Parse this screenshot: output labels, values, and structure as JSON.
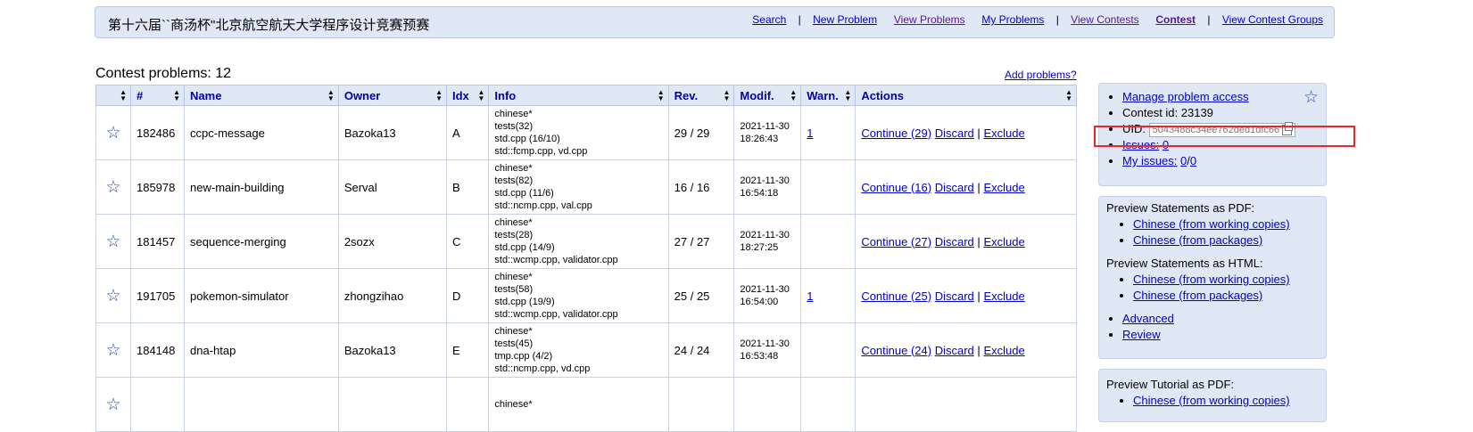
{
  "header": {
    "title": "第十六届``商汤杯\"北京航空航天大学程序设计竞赛预赛",
    "nav": {
      "search": "Search",
      "new_problem": "New Problem",
      "view_problems": "View Problems",
      "my_problems": "My Problems",
      "view_contests": "View Contests",
      "contest": "Contest",
      "view_contest_groups": "View Contest Groups",
      "separator": "|"
    }
  },
  "contest": {
    "heading": "Contest problems: 12",
    "add_problems": "Add problems?"
  },
  "table": {
    "columns": {
      "hash": "#",
      "name": "Name",
      "owner": "Owner",
      "idx": "Idx",
      "info": "Info",
      "rev": "Rev.",
      "modif": "Modif.",
      "warn": "Warn.",
      "actions": "Actions"
    },
    "sort_icon": "sort-arrows-icon",
    "star_icon": "star-icon",
    "action_labels": {
      "discard": "Discard",
      "exclude": "Exclude",
      "pipe": "|"
    },
    "rows": [
      {
        "id": "182486",
        "name": "ccpc-message",
        "owner": "Bazoka13",
        "idx": "A",
        "info": [
          "chinese*",
          "tests(32)",
          "std.cpp (16/10)",
          "std::fcmp.cpp, vd.cpp"
        ],
        "rev": "29 / 29",
        "date": "2021-11-30",
        "time": "18:26:43",
        "warn": "1",
        "continue": "Continue (29)"
      },
      {
        "id": "185978",
        "name": "new-main-building",
        "owner": "Serval",
        "idx": "B",
        "info": [
          "chinese*",
          "tests(82)",
          "std.cpp (11/6)",
          "std::ncmp.cpp, val.cpp"
        ],
        "rev": "16 / 16",
        "date": "2021-11-30",
        "time": "16:54:18",
        "warn": "",
        "continue": "Continue (16)"
      },
      {
        "id": "181457",
        "name": "sequence-merging",
        "owner": "2sozx",
        "idx": "C",
        "info": [
          "chinese*",
          "tests(28)",
          "std.cpp (14/9)",
          "std::wcmp.cpp, validator.cpp"
        ],
        "rev": "27 / 27",
        "date": "2021-11-30",
        "time": "18:27:25",
        "warn": "",
        "continue": "Continue (27)"
      },
      {
        "id": "191705",
        "name": "pokemon-simulator",
        "owner": "zhongzihao",
        "idx": "D",
        "info": [
          "chinese*",
          "tests(58)",
          "std.cpp (19/9)",
          "std::wcmp.cpp, validator.cpp"
        ],
        "rev": "25 / 25",
        "date": "2021-11-30",
        "time": "16:54:00",
        "warn": "1",
        "continue": "Continue (25)"
      },
      {
        "id": "184148",
        "name": "dna-htap",
        "owner": "Bazoka13",
        "idx": "E",
        "info": [
          "chinese*",
          "tests(45)",
          "tmp.cpp (4/2)",
          "std::ncmp.cpp, vd.cpp"
        ],
        "rev": "24 / 24",
        "date": "2021-11-30",
        "time": "16:53:48",
        "warn": "",
        "continue": "Continue (24)"
      },
      {
        "id": "",
        "name": "",
        "owner": "",
        "idx": "",
        "info": [
          "chinese*"
        ],
        "rev": "",
        "date": "",
        "time": "",
        "warn": "",
        "continue": ""
      }
    ]
  },
  "sidebar": {
    "box1": {
      "manage_access": "Manage problem access",
      "contest_id": "Contest id: 23139",
      "uid_label": "UID:",
      "uid_value": "5043488c34ee762ded1dfc66",
      "issues_label": "Issues:",
      "issues_count": "0",
      "my_issues_label": "My issues:",
      "my_issues_open": "0",
      "my_issues_total": "0",
      "slash": "/"
    },
    "box2": {
      "pdf_heading": "Preview Statements as PDF:",
      "pdf_items": [
        "Chinese (from working copies)",
        "Chinese (from packages)"
      ],
      "html_heading": "Preview Statements as HTML:",
      "html_items": [
        "Chinese (from working copies)",
        "Chinese (from packages)"
      ],
      "advanced": "Advanced",
      "review": "Review"
    },
    "box3": {
      "heading": "Preview Tutorial as PDF:",
      "items": [
        "Chinese (from working copies)"
      ]
    }
  },
  "colors": {
    "panel": "#e1e8f5",
    "link": "#0000cc",
    "visited": "#551a8b",
    "highlight": "#e8262b",
    "star": "#2a4bb0"
  }
}
